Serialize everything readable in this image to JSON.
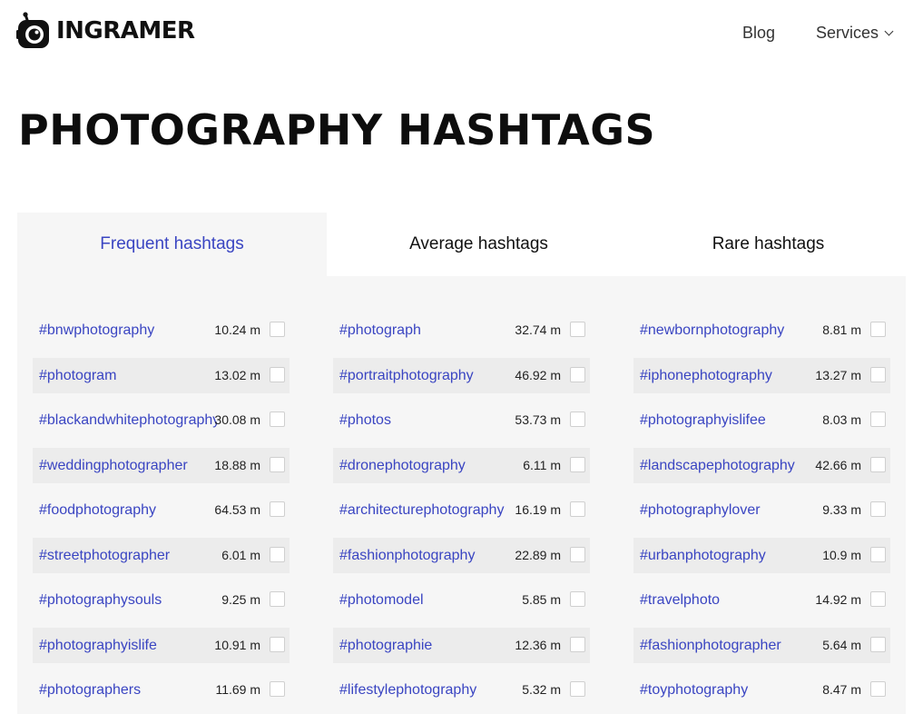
{
  "header": {
    "brand": "INGRAMER",
    "logo_icon": "camera-robot-icon",
    "nav": {
      "blog": "Blog",
      "services": "Services"
    }
  },
  "title": "PHOTOGRAPHY HASHTAGS",
  "tabs": [
    {
      "label": "Frequent hashtags",
      "active": true
    },
    {
      "label": "Average hashtags",
      "active": false
    },
    {
      "label": "Rare hashtags",
      "active": false
    }
  ],
  "colors": {
    "accent": "#3a45c2",
    "panel_bg": "#f6f6f6",
    "row_shade": "#ececec"
  },
  "columns": [
    [
      {
        "tag": "#bnwphotography",
        "count": "10.24 m"
      },
      {
        "tag": "#photogram",
        "count": "13.02 m"
      },
      {
        "tag": "#blackandwhitephotography",
        "count": "30.08 m"
      },
      {
        "tag": "#weddingphotographer",
        "count": "18.88 m"
      },
      {
        "tag": "#foodphotography",
        "count": "64.53 m"
      },
      {
        "tag": "#streetphotographer",
        "count": "6.01 m"
      },
      {
        "tag": "#photographysouls",
        "count": "9.25 m"
      },
      {
        "tag": "#photographyislife",
        "count": "10.91 m"
      },
      {
        "tag": "#photographers",
        "count": "11.69 m"
      }
    ],
    [
      {
        "tag": "#photograph",
        "count": "32.74 m"
      },
      {
        "tag": "#portraitphotography",
        "count": "46.92 m"
      },
      {
        "tag": "#photos",
        "count": "53.73 m"
      },
      {
        "tag": "#dronephotography",
        "count": "6.11 m"
      },
      {
        "tag": "#architecturephotography",
        "count": "16.19 m"
      },
      {
        "tag": "#fashionphotography",
        "count": "22.89 m"
      },
      {
        "tag": "#photomodel",
        "count": "5.85 m"
      },
      {
        "tag": "#photographie",
        "count": "12.36 m"
      },
      {
        "tag": "#lifestylephotography",
        "count": "5.32 m"
      }
    ],
    [
      {
        "tag": "#newbornphotography",
        "count": "8.81 m"
      },
      {
        "tag": "#iphonephotography",
        "count": "13.27 m"
      },
      {
        "tag": "#photographyislifee",
        "count": "8.03 m"
      },
      {
        "tag": "#landscapephotography",
        "count": "42.66 m"
      },
      {
        "tag": "#photographylover",
        "count": "9.33 m"
      },
      {
        "tag": "#urbanphotography",
        "count": "10.9 m"
      },
      {
        "tag": "#travelphoto",
        "count": "14.92 m"
      },
      {
        "tag": "#fashionphotographer",
        "count": "5.64 m"
      },
      {
        "tag": "#toyphotography",
        "count": "8.47 m"
      }
    ]
  ]
}
